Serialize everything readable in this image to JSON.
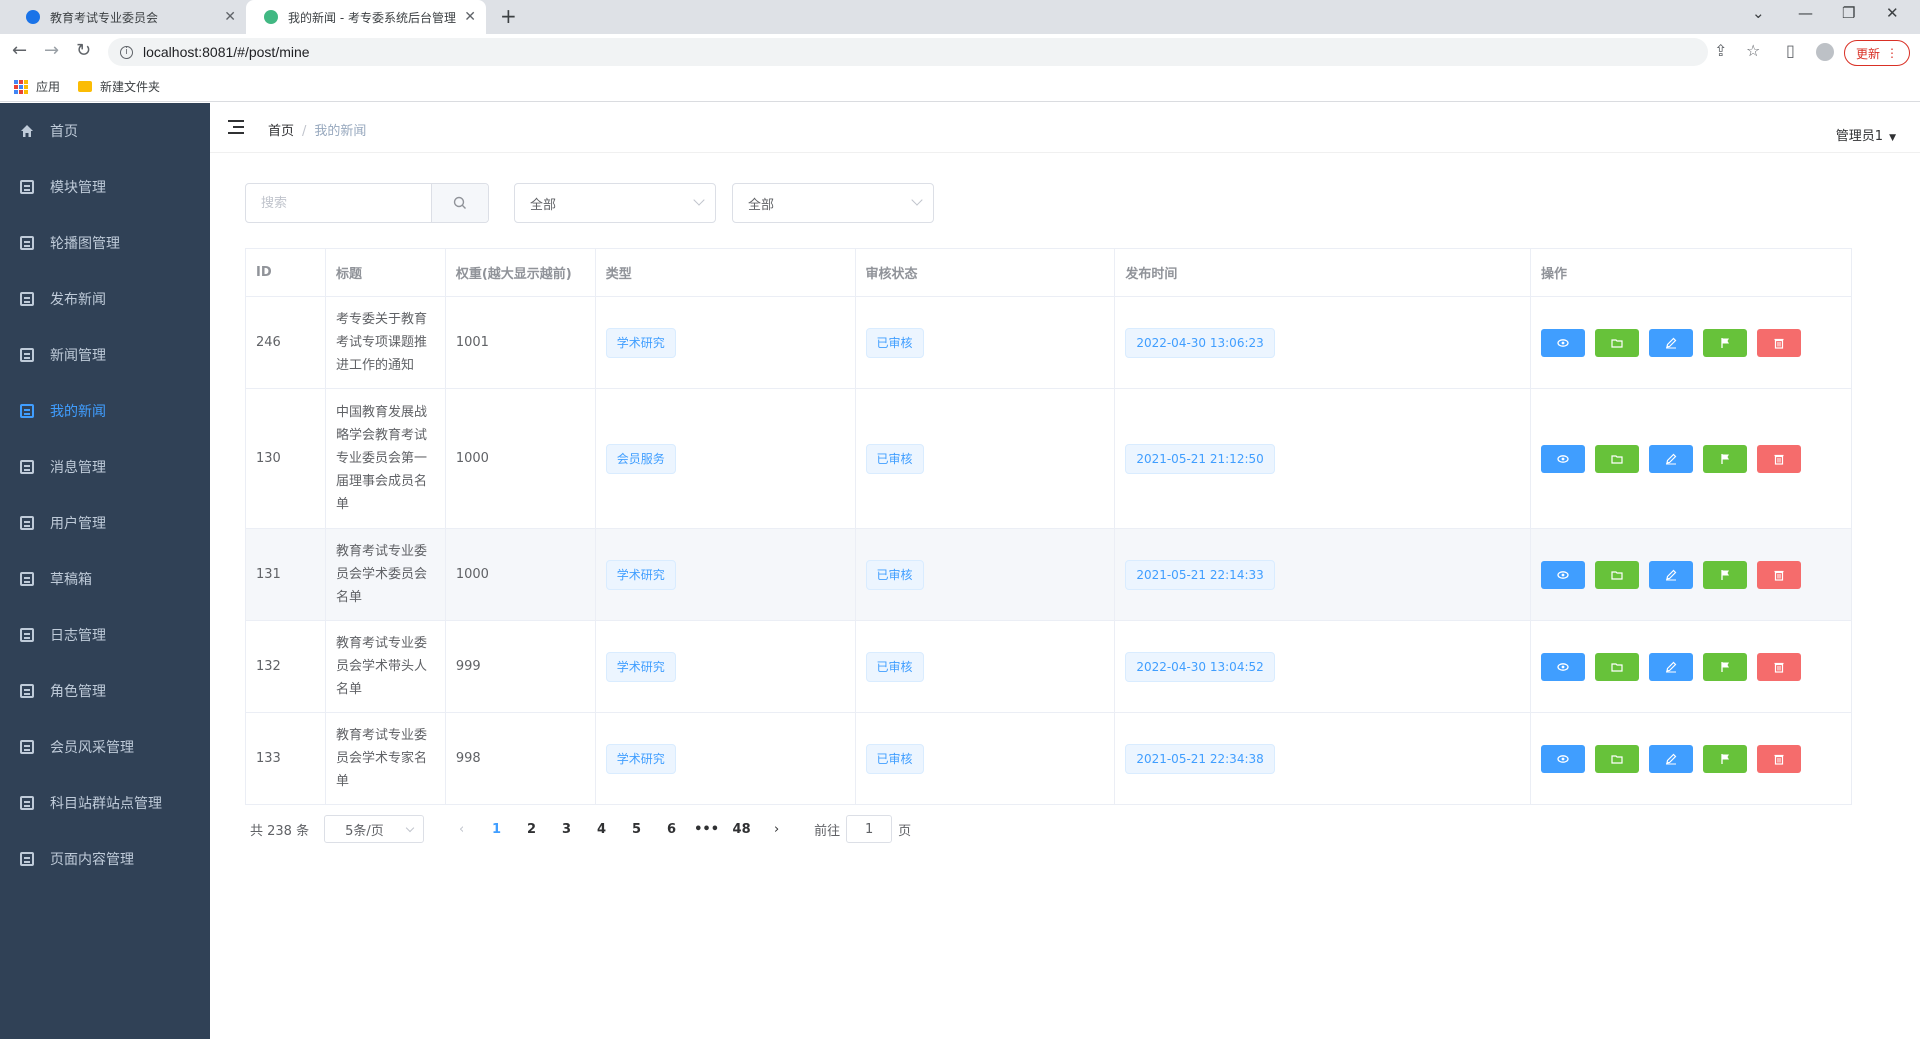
{
  "browser": {
    "tabs": [
      {
        "title": "教育考试专业委员会",
        "close": "✕"
      },
      {
        "title": "我的新闻 - 考专委系统后台管理",
        "close": "✕"
      }
    ],
    "new_tab": "+",
    "url": "localhost:8081/#/post/mine",
    "update_label": "更新",
    "bookmarks": [
      {
        "label": "应用"
      },
      {
        "label": "新建文件夹"
      }
    ]
  },
  "sidebar": {
    "items": [
      {
        "label": "首页",
        "icon": "home-icon"
      },
      {
        "label": "模块管理",
        "icon": "document-icon"
      },
      {
        "label": "轮播图管理",
        "icon": "document-icon"
      },
      {
        "label": "发布新闻",
        "icon": "document-icon"
      },
      {
        "label": "新闻管理",
        "icon": "document-icon"
      },
      {
        "label": "我的新闻",
        "icon": "document-icon",
        "active": true
      },
      {
        "label": "消息管理",
        "icon": "document-icon"
      },
      {
        "label": "用户管理",
        "icon": "document-icon"
      },
      {
        "label": "草稿箱",
        "icon": "document-icon"
      },
      {
        "label": "日志管理",
        "icon": "document-icon"
      },
      {
        "label": "角色管理",
        "icon": "document-icon"
      },
      {
        "label": "会员风采管理",
        "icon": "document-icon"
      },
      {
        "label": "科目站群站点管理",
        "icon": "document-icon"
      },
      {
        "label": "页面内容管理",
        "icon": "document-icon"
      }
    ]
  },
  "header": {
    "breadcrumb": [
      "首页",
      "我的新闻"
    ],
    "separator": "/",
    "user": "管理员1"
  },
  "filters": {
    "search_placeholder": "搜索",
    "select1": "全部",
    "select2": "全部"
  },
  "table": {
    "columns": [
      "ID",
      "标题",
      "权重(越大显示越前)",
      "类型",
      "审核状态",
      "发布时间",
      "操作"
    ],
    "rows": [
      {
        "id": "246",
        "title": "考专委关于教育考试专项课题推进工作的通知",
        "weight": "1001",
        "type": "学术研究",
        "status": "已审核",
        "time": "2022-04-30 13:06:23"
      },
      {
        "id": "130",
        "title": "中国教育发展战略学会教育考试专业委员会第一届理事会成员名单",
        "weight": "1000",
        "type": "会员服务",
        "status": "已审核",
        "time": "2021-05-21 21:12:50"
      },
      {
        "id": "131",
        "title": "教育考试专业委员会学术委员会名单",
        "weight": "1000",
        "type": "学术研究",
        "status": "已审核",
        "time": "2021-05-21 22:14:33"
      },
      {
        "id": "132",
        "title": "教育考试专业委员会学术带头人名单",
        "weight": "999",
        "type": "学术研究",
        "status": "已审核",
        "time": "2022-04-30 13:04:52"
      },
      {
        "id": "133",
        "title": "教育考试专业委员会学术专家名单",
        "weight": "998",
        "type": "学术研究",
        "status": "已审核",
        "time": "2021-05-21 22:34:38"
      }
    ],
    "actions": [
      {
        "icon": "eye-icon",
        "color": "#409eff"
      },
      {
        "icon": "folder-icon",
        "color": "#67c23a"
      },
      {
        "icon": "edit-icon",
        "color": "#409eff"
      },
      {
        "icon": "flag-icon",
        "color": "#67c23a"
      },
      {
        "icon": "trash-icon",
        "color": "#f56c6c"
      }
    ]
  },
  "pagination": {
    "total": "共 238 条",
    "page_size": "5条/页",
    "pages": [
      "1",
      "2",
      "3",
      "4",
      "5",
      "6",
      "•••",
      "48"
    ],
    "current": "1",
    "goto_prefix": "前往",
    "goto_value": "1",
    "goto_suffix": "页"
  },
  "colors": {
    "sidebar_bg": "#304156",
    "sidebar_text": "#bfcbd9",
    "accent": "#409eff",
    "success": "#67c23a",
    "danger": "#f56c6c"
  }
}
